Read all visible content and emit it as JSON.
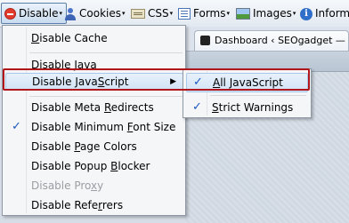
{
  "toolbar": {
    "disable": "Disable",
    "cookies": "Cookies",
    "css": "CSS",
    "forms": "Forms",
    "images": "Images",
    "information": "Inform"
  },
  "browser_tab": {
    "title": "Dashboard ‹ SEOgadget —"
  },
  "menu": {
    "items": [
      {
        "pre": "",
        "u": "D",
        "post": "isable Cache"
      },
      {
        "pre": "Disable ",
        "u": "J",
        "post": "ava"
      },
      {
        "pre": "Disable Java",
        "u": "S",
        "post": "cript"
      },
      {
        "pre": "Disable Meta ",
        "u": "R",
        "post": "edirects"
      },
      {
        "pre": "Disable Minimum ",
        "u": "F",
        "post": "ont Size"
      },
      {
        "pre": "Disable ",
        "u": "P",
        "post": "age Colors"
      },
      {
        "pre": "Disable Popup ",
        "u": "B",
        "post": "locker"
      },
      {
        "pre": "Disable Pro",
        "u": "x",
        "post": "y"
      },
      {
        "pre": "Disable Refe",
        "u": "r",
        "post": "rers"
      }
    ]
  },
  "submenu": {
    "items": [
      {
        "pre": "",
        "u": "A",
        "post": "ll JavaScript"
      },
      {
        "pre": "",
        "u": "S",
        "post": "trict Warnings"
      }
    ]
  },
  "glyphs": {
    "check": "✓",
    "submenu_arrow": "▶",
    "dropdown_arrow": "▾",
    "info": "i"
  },
  "colors": {
    "highlight_border": "#b0161c",
    "check": "#1b56c0"
  }
}
